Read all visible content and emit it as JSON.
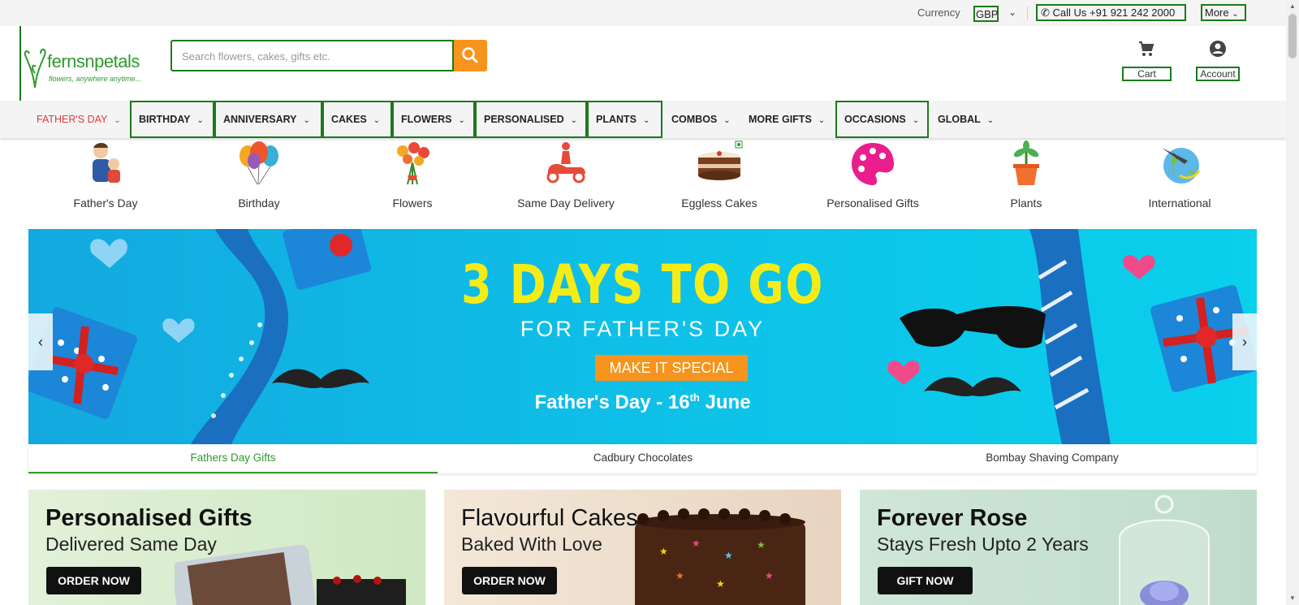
{
  "topbar": {
    "currency_label": "Currency",
    "currency_value": "GBP",
    "call_label": "Call Us +91 921 242 2000",
    "more_label": "More"
  },
  "header": {
    "brand": "fernsnpetals",
    "tagline": "flowers, anywhere anytime...",
    "search_placeholder": "Search flowers, cakes, gifts etc.",
    "cart_label": "Cart",
    "account_label": "Account"
  },
  "nav": {
    "items": [
      {
        "label": "FATHER'S DAY"
      },
      {
        "label": "BIRTHDAY"
      },
      {
        "label": "ANNIVERSARY"
      },
      {
        "label": "CAKES"
      },
      {
        "label": "FLOWERS"
      },
      {
        "label": "PERSONALISED"
      },
      {
        "label": "PLANTS"
      },
      {
        "label": "COMBOS"
      },
      {
        "label": "MORE GIFTS"
      },
      {
        "label": "OCCASIONS"
      },
      {
        "label": "GLOBAL"
      }
    ]
  },
  "categories": [
    {
      "label": "Father's Day"
    },
    {
      "label": "Birthday"
    },
    {
      "label": "Flowers"
    },
    {
      "label": "Same Day Delivery"
    },
    {
      "label": "Eggless Cakes"
    },
    {
      "label": "Personalised Gifts"
    },
    {
      "label": "Plants"
    },
    {
      "label": "International"
    }
  ],
  "banner": {
    "headline": "3 DAYS TO GO",
    "subheadline": "FOR FATHER'S DAY",
    "cta": "MAKE IT SPECIAL",
    "date_text": "Father's Day - 16",
    "date_suffix": "th",
    "date_month": "June"
  },
  "tabs": [
    {
      "label": "Fathers Day Gifts"
    },
    {
      "label": "Cadbury Chocolates"
    },
    {
      "label": "Bombay Shaving Company"
    }
  ],
  "promos": [
    {
      "title": "Personalised Gifts",
      "subtitle": "Delivered Same Day",
      "button": "ORDER NOW"
    },
    {
      "title": "Flavourful Cakes",
      "subtitle": "Baked With Love",
      "button": "ORDER NOW"
    },
    {
      "title": "Forever Rose",
      "subtitle": "Stays Fresh Upto 2 Years",
      "button": "GIFT NOW"
    }
  ],
  "colors": {
    "brand_green": "#2d9a2d",
    "accent_orange": "#f7941d",
    "nav_highlight_red": "#e03a3a",
    "banner_blue": "#13a9df",
    "banner_yellow": "#f5ec17"
  }
}
